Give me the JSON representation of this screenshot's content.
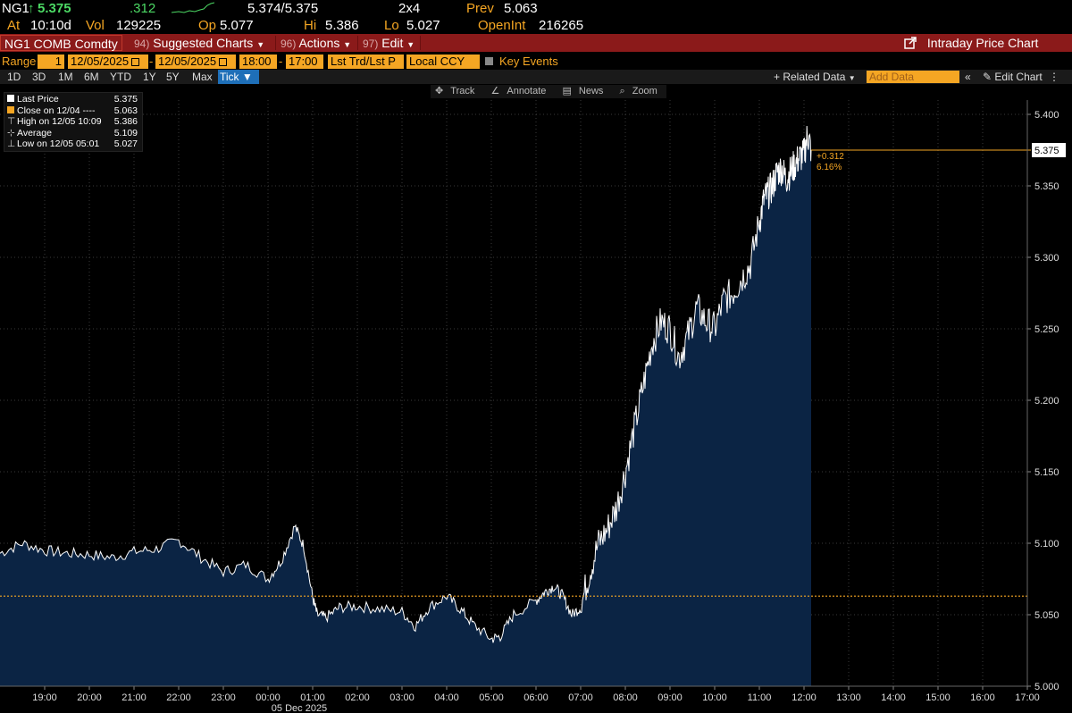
{
  "header": {
    "ticker": "NG1",
    "arrow": "↑",
    "last": "5.375",
    "change": ".312",
    "bid_ask": "5.374/5.375",
    "size": "2x4",
    "prev_label": "Prev",
    "prev": "5.063",
    "at_label": "At",
    "at_time": "10:10d",
    "vol_label": "Vol",
    "vol": "129225",
    "op_label": "Op",
    "op": "5.077",
    "hi_label": "Hi",
    "hi": "5.386",
    "lo_label": "Lo",
    "lo": "5.027",
    "oi_label": "OpenInt",
    "oi": "216265"
  },
  "redbar": {
    "security": "NG1 COMB Comdty",
    "suggested_num": "94)",
    "suggested": "Suggested Charts",
    "actions_num": "96)",
    "actions": "Actions",
    "edit_num": "97)",
    "edit": "Edit",
    "title": "Intraday Price Chart"
  },
  "rangebar": {
    "range_label": "Range",
    "range_value": "1",
    "start_date": "12/05/2025",
    "end_date": "12/05/2025",
    "start_time": "18:00",
    "end_time": "17:00",
    "price_type": "Lst Trd/Lst P",
    "currency": "Local CCY",
    "key_events": "Key Events"
  },
  "periods": [
    "1D",
    "3D",
    "1M",
    "6M",
    "YTD",
    "1Y",
    "5Y",
    "Max",
    "Tick ▼"
  ],
  "toolbar": {
    "related_data": "+ Related Data",
    "add_data_placeholder": "Add Data",
    "edit_chart": "Edit Chart"
  },
  "charttools": {
    "track": "Track",
    "annotate": "Annotate",
    "news": "News",
    "zoom": "Zoom"
  },
  "legend": [
    {
      "label": "Last Price",
      "value": "5.375",
      "marker": "#ffffff"
    },
    {
      "label": "Close on 12/04 ----",
      "value": "5.063",
      "marker": "#f5a623"
    },
    {
      "label": "High on 12/05 10:09",
      "value": "5.386",
      "marker": "#cccccc"
    },
    {
      "label": "Average",
      "value": "5.109",
      "marker": "#cccccc"
    },
    {
      "label": "Low on 12/05 05:01",
      "value": "5.027",
      "marker": "#cccccc"
    }
  ],
  "colors": {
    "background": "#000000",
    "area_fill": "#0b2444",
    "price_line": "#ffffff",
    "prev_close_line": "#f5a623",
    "grid": "#3a3a3a"
  },
  "chart_data": {
    "type": "area",
    "ylim": [
      5.0,
      5.41
    ],
    "yticks": [
      "5.000",
      "5.050",
      "5.100",
      "5.150",
      "5.200",
      "5.250",
      "5.300",
      "5.350",
      "5.400"
    ],
    "xticks": [
      "19:00",
      "20:00",
      "21:00",
      "22:00",
      "23:00",
      "00:00",
      "01:00",
      "02:00",
      "03:00",
      "04:00",
      "05:00",
      "06:00",
      "07:00",
      "08:00",
      "09:00",
      "10:00",
      "11:00",
      "12:00",
      "13:00",
      "14:00",
      "15:00",
      "16:00",
      "17:00"
    ],
    "xaxis_date": "05 Dec 2025",
    "last_label": "5.375",
    "change_label": "+0.312",
    "change_pct_label": "6.16%",
    "prev_close": 5.063,
    "last_price": 5.375,
    "x_hours": [
      18.0,
      18.5,
      19.0,
      19.5,
      20.0,
      20.5,
      21.0,
      21.5,
      22.0,
      22.5,
      23.0,
      23.5,
      24.0,
      24.3,
      24.6,
      24.8,
      25.0,
      25.1,
      25.3,
      25.6,
      26.0,
      26.5,
      27.0,
      27.3,
      27.6,
      28.0,
      28.3,
      28.6,
      29.0,
      29.2,
      29.5,
      30.0,
      30.2,
      30.4,
      30.6,
      30.8,
      31.0,
      31.2,
      31.4,
      31.6,
      31.8,
      32.0,
      32.2,
      32.4,
      32.6,
      32.8,
      33.0,
      33.2,
      33.4,
      33.6,
      33.8,
      34.0,
      34.2,
      34.4,
      34.6,
      34.8,
      35.0,
      35.1,
      35.2,
      35.3,
      35.4,
      35.5,
      35.6,
      35.7,
      35.8,
      35.9,
      36.0,
      36.08,
      36.16
    ],
    "price": [
      5.093,
      5.1,
      5.095,
      5.093,
      5.092,
      5.09,
      5.094,
      5.096,
      5.102,
      5.09,
      5.08,
      5.085,
      5.075,
      5.088,
      5.112,
      5.098,
      5.062,
      5.05,
      5.048,
      5.055,
      5.056,
      5.054,
      5.052,
      5.042,
      5.055,
      5.063,
      5.054,
      5.043,
      5.033,
      5.035,
      5.05,
      5.06,
      5.066,
      5.07,
      5.063,
      5.05,
      5.055,
      5.08,
      5.1,
      5.11,
      5.125,
      5.15,
      5.18,
      5.21,
      5.24,
      5.255,
      5.25,
      5.23,
      5.245,
      5.265,
      5.255,
      5.25,
      5.27,
      5.275,
      5.285,
      5.295,
      5.325,
      5.34,
      5.345,
      5.35,
      5.36,
      5.362,
      5.355,
      5.36,
      5.365,
      5.37,
      5.372,
      5.386,
      5.375
    ]
  }
}
